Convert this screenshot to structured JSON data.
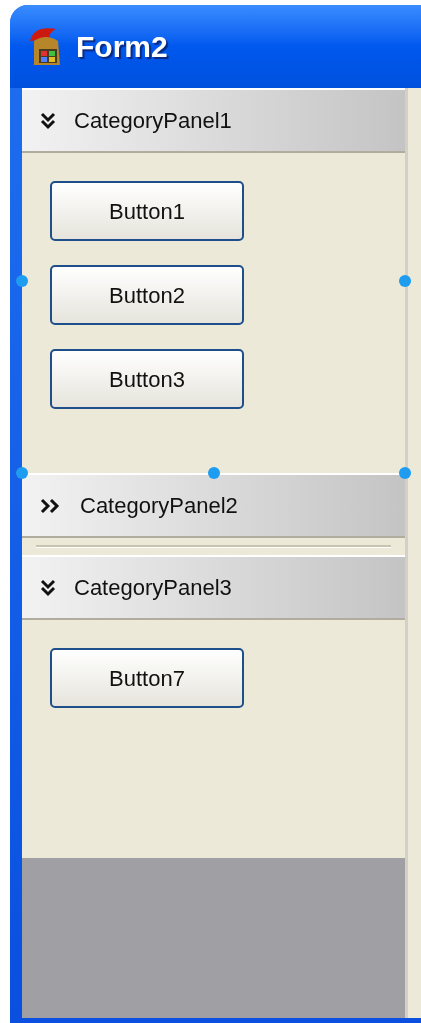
{
  "window": {
    "title": "Form2"
  },
  "panels": [
    {
      "title": "CategoryPanel1",
      "expanded": true,
      "selected": true,
      "buttons": [
        "Button1",
        "Button2",
        "Button3"
      ]
    },
    {
      "title": "CategoryPanel2",
      "expanded": false,
      "selected": false
    },
    {
      "title": "CategoryPanel3",
      "expanded": true,
      "selected": false,
      "buttons": [
        "Button7"
      ]
    }
  ]
}
